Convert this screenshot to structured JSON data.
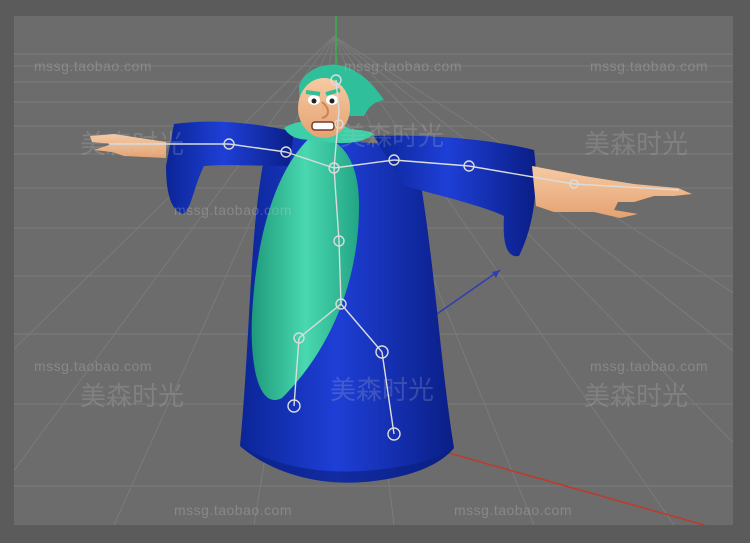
{
  "viewport": {
    "background": "#6c6c6c",
    "grid_color": "#7a7a7a",
    "axis_colors": {
      "x": "#c0392b",
      "y": "#36b24a",
      "z": "#2f3fb0"
    }
  },
  "watermark": {
    "url": "mssg.taobao.com",
    "brand": "美森时光"
  },
  "model": {
    "robe_color": "#1633b8",
    "beard_color": "#2fbf9a",
    "skin_color": "#f2b98b",
    "rig_color": "#d8d8d8"
  }
}
